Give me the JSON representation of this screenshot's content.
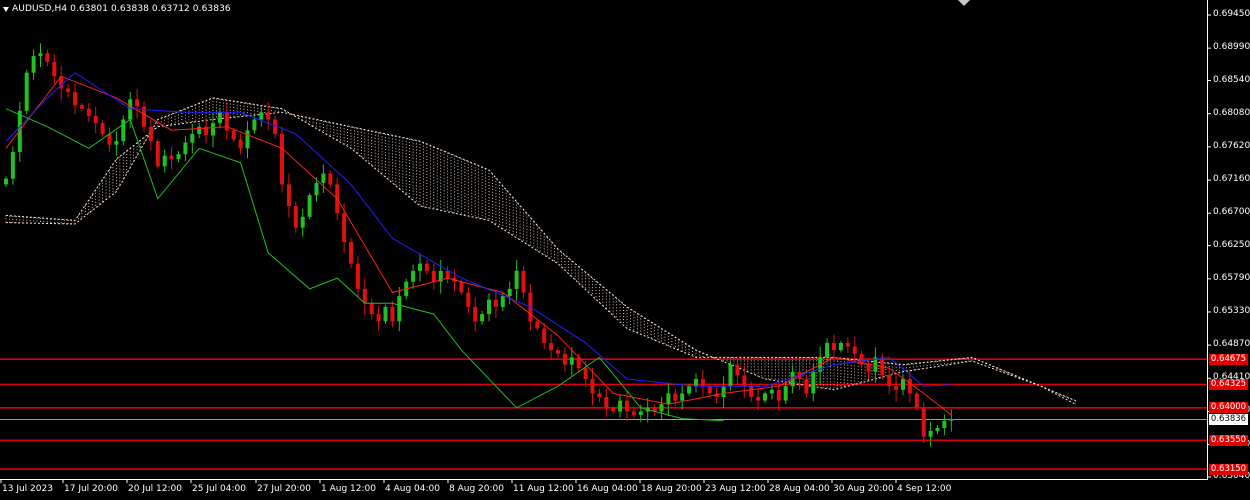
{
  "header": {
    "symbol": "AUDUSD,H4",
    "ohlc": "0.63801 0.63838 0.63712 0.63836"
  },
  "y_axis": {
    "labels": [
      "0.69450",
      "0.68990",
      "0.68540",
      "0.68080",
      "0.67620",
      "0.67160",
      "0.66700",
      "0.66250",
      "0.65790",
      "0.65330",
      "0.64870",
      "0.64410",
      "0.63950",
      "0.63490",
      "0.63040"
    ]
  },
  "x_axis": {
    "labels": [
      "13 Jul 2023",
      "17 Jul 20:00",
      "20 Jul 12:00",
      "25 Jul 04:00",
      "27 Jul 20:00",
      "1 Aug 12:00",
      "4 Aug 04:00",
      "8 Aug 20:00",
      "11 Aug 12:00",
      "16 Aug 04:00",
      "18 Aug 20:00",
      "23 Aug 12:00",
      "28 Aug 04:00",
      "30 Aug 20:00",
      "4 Sep 12:00"
    ]
  },
  "levels": [
    {
      "label": "0.64675",
      "price": 0.64675
    },
    {
      "label": "0.64325",
      "price": 0.64325
    },
    {
      "label": "0.64000",
      "price": 0.64
    },
    {
      "label": "0.63550",
      "price": 0.6355
    },
    {
      "label": "0.63150",
      "price": 0.6315
    }
  ],
  "current_price": {
    "label": "0.63836",
    "price": 0.63836
  },
  "colors": {
    "background": "#000000",
    "bull": "#22c022",
    "bear": "#e01010",
    "level": "#e00000",
    "tenkan": "#ff2020",
    "kijun": "#2020ff",
    "chikou": "#20c020",
    "cloud": "#ffe6d2"
  },
  "chart_data": {
    "type": "candlestick",
    "title": "AUDUSD,H4",
    "ylim": [
      0.6304,
      0.6945
    ],
    "price_path": [
      [
        0,
        0.6718
      ],
      [
        1,
        0.6755
      ],
      [
        2,
        0.6812
      ],
      [
        3,
        0.6865
      ],
      [
        4,
        0.6888
      ],
      [
        5,
        0.6892
      ],
      [
        6,
        0.688
      ],
      [
        7,
        0.686
      ],
      [
        8,
        0.6843
      ],
      [
        9,
        0.6838
      ],
      [
        10,
        0.682
      ],
      [
        11,
        0.6815
      ],
      [
        12,
        0.6805
      ],
      [
        13,
        0.6795
      ],
      [
        14,
        0.678
      ],
      [
        15,
        0.6765
      ],
      [
        16,
        0.677
      ],
      [
        17,
        0.68
      ],
      [
        18,
        0.6828
      ],
      [
        19,
        0.6818
      ],
      [
        20,
        0.679
      ],
      [
        21,
        0.677
      ],
      [
        22,
        0.6735
      ],
      [
        23,
        0.675
      ],
      [
        24,
        0.6745
      ],
      [
        25,
        0.6752
      ],
      [
        26,
        0.6768
      ],
      [
        27,
        0.678
      ],
      [
        28,
        0.679
      ],
      [
        29,
        0.6778
      ],
      [
        30,
        0.6795
      ],
      [
        31,
        0.681
      ],
      [
        32,
        0.6785
      ],
      [
        33,
        0.6772
      ],
      [
        34,
        0.676
      ],
      [
        35,
        0.6785
      ],
      [
        36,
        0.68
      ],
      [
        37,
        0.681
      ],
      [
        38,
        0.68
      ],
      [
        39,
        0.678
      ],
      [
        40,
        0.671
      ],
      [
        41,
        0.668
      ],
      [
        42,
        0.665
      ],
      [
        43,
        0.6665
      ],
      [
        44,
        0.6695
      ],
      [
        45,
        0.6712
      ],
      [
        46,
        0.6725
      ],
      [
        47,
        0.671
      ],
      [
        48,
        0.667
      ],
      [
        49,
        0.663
      ],
      [
        50,
        0.66
      ],
      [
        51,
        0.6565
      ],
      [
        52,
        0.6545
      ],
      [
        53,
        0.653
      ],
      [
        54,
        0.652
      ],
      [
        55,
        0.654
      ],
      [
        56,
        0.652
      ],
      [
        57,
        0.6555
      ],
      [
        58,
        0.6575
      ],
      [
        59,
        0.659
      ],
      [
        60,
        0.66
      ],
      [
        61,
        0.659
      ],
      [
        62,
        0.6575
      ],
      [
        63,
        0.659
      ],
      [
        64,
        0.658
      ],
      [
        65,
        0.6575
      ],
      [
        66,
        0.656
      ],
      [
        67,
        0.654
      ],
      [
        68,
        0.652
      ],
      [
        69,
        0.653
      ],
      [
        70,
        0.655
      ],
      [
        71,
        0.654
      ],
      [
        72,
        0.6555
      ],
      [
        73,
        0.6565
      ],
      [
        74,
        0.659
      ],
      [
        75,
        0.656
      ],
      [
        76,
        0.652
      ],
      [
        77,
        0.651
      ],
      [
        78,
        0.649
      ],
      [
        79,
        0.648
      ],
      [
        80,
        0.6475
      ],
      [
        81,
        0.646
      ],
      [
        82,
        0.647
      ],
      [
        83,
        0.6455
      ],
      [
        84,
        0.644
      ],
      [
        85,
        0.642
      ],
      [
        86,
        0.6415
      ],
      [
        87,
        0.64
      ],
      [
        88,
        0.6395
      ],
      [
        89,
        0.641
      ],
      [
        90,
        0.6395
      ],
      [
        91,
        0.639
      ],
      [
        92,
        0.6395
      ],
      [
        93,
        0.64
      ],
      [
        94,
        0.6395
      ],
      [
        95,
        0.6405
      ],
      [
        96,
        0.642
      ],
      [
        97,
        0.641
      ],
      [
        98,
        0.642
      ],
      [
        99,
        0.643
      ],
      [
        100,
        0.644
      ],
      [
        101,
        0.643
      ],
      [
        102,
        0.642
      ],
      [
        103,
        0.6415
      ],
      [
        104,
        0.643
      ],
      [
        105,
        0.646
      ],
      [
        106,
        0.6445
      ],
      [
        107,
        0.643
      ],
      [
        108,
        0.6415
      ],
      [
        109,
        0.641
      ],
      [
        110,
        0.642
      ],
      [
        111,
        0.6425
      ],
      [
        112,
        0.641
      ],
      [
        113,
        0.643
      ],
      [
        114,
        0.645
      ],
      [
        115,
        0.644
      ],
      [
        116,
        0.642
      ],
      [
        117,
        0.645
      ],
      [
        118,
        0.647
      ],
      [
        119,
        0.649
      ],
      [
        120,
        0.648
      ],
      [
        121,
        0.649
      ],
      [
        122,
        0.6485
      ],
      [
        123,
        0.6475
      ],
      [
        124,
        0.646
      ],
      [
        125,
        0.645
      ],
      [
        126,
        0.647
      ],
      [
        127,
        0.6445
      ],
      [
        128,
        0.643
      ],
      [
        129,
        0.6425
      ],
      [
        130,
        0.644
      ],
      [
        131,
        0.642
      ],
      [
        132,
        0.64
      ],
      [
        133,
        0.636
      ],
      [
        134,
        0.6368
      ],
      [
        135,
        0.6372
      ],
      [
        136,
        0.6382
      ],
      [
        137,
        0.6384
      ]
    ],
    "tenkan": [
      [
        0,
        0.676
      ],
      [
        8,
        0.686
      ],
      [
        16,
        0.683
      ],
      [
        24,
        0.6785
      ],
      [
        32,
        0.679
      ],
      [
        40,
        0.676
      ],
      [
        48,
        0.669
      ],
      [
        56,
        0.656
      ],
      [
        64,
        0.658
      ],
      [
        72,
        0.656
      ],
      [
        80,
        0.65
      ],
      [
        88,
        0.642
      ],
      [
        96,
        0.6405
      ],
      [
        104,
        0.642
      ],
      [
        112,
        0.643
      ],
      [
        120,
        0.647
      ],
      [
        128,
        0.6455
      ],
      [
        133,
        0.642
      ],
      [
        137,
        0.639
      ]
    ],
    "kijun": [
      [
        0,
        0.677
      ],
      [
        6,
        0.683
      ],
      [
        10,
        0.6865
      ],
      [
        18,
        0.6815
      ],
      [
        26,
        0.681
      ],
      [
        34,
        0.681
      ],
      [
        42,
        0.678
      ],
      [
        50,
        0.671
      ],
      [
        56,
        0.6635
      ],
      [
        66,
        0.658
      ],
      [
        76,
        0.654
      ],
      [
        84,
        0.649
      ],
      [
        90,
        0.644
      ],
      [
        100,
        0.643
      ],
      [
        110,
        0.643
      ],
      [
        120,
        0.646
      ],
      [
        128,
        0.647
      ],
      [
        133,
        0.643
      ],
      [
        137,
        0.6432
      ]
    ],
    "chikou": [
      [
        0,
        0.6815
      ],
      [
        6,
        0.679
      ],
      [
        12,
        0.676
      ],
      [
        18,
        0.68
      ],
      [
        22,
        0.669
      ],
      [
        28,
        0.676
      ],
      [
        34,
        0.674
      ],
      [
        38,
        0.6615
      ],
      [
        44,
        0.6565
      ],
      [
        48,
        0.658
      ],
      [
        52,
        0.6545
      ],
      [
        56,
        0.6545
      ],
      [
        62,
        0.653
      ],
      [
        66,
        0.648
      ],
      [
        70,
        0.644
      ],
      [
        74,
        0.64
      ],
      [
        80,
        0.643
      ],
      [
        86,
        0.647
      ],
      [
        92,
        0.64
      ],
      [
        98,
        0.6385
      ],
      [
        104,
        0.6382
      ]
    ],
    "cloud_a": [
      [
        0,
        0.6667
      ],
      [
        10,
        0.666
      ],
      [
        16,
        0.6745
      ],
      [
        22,
        0.679
      ],
      [
        30,
        0.68
      ],
      [
        40,
        0.681
      ],
      [
        50,
        0.679
      ],
      [
        60,
        0.677
      ],
      [
        70,
        0.673
      ],
      [
        80,
        0.662
      ],
      [
        90,
        0.654
      ],
      [
        100,
        0.648
      ],
      [
        110,
        0.644
      ],
      [
        120,
        0.6425
      ],
      [
        130,
        0.645
      ],
      [
        140,
        0.6465
      ],
      [
        150,
        0.643
      ],
      [
        155,
        0.6405
      ]
    ],
    "cloud_b": [
      [
        0,
        0.6657
      ],
      [
        10,
        0.6655
      ],
      [
        16,
        0.67
      ],
      [
        22,
        0.68
      ],
      [
        30,
        0.683
      ],
      [
        40,
        0.6815
      ],
      [
        50,
        0.676
      ],
      [
        60,
        0.668
      ],
      [
        70,
        0.666
      ],
      [
        80,
        0.66
      ],
      [
        90,
        0.651
      ],
      [
        100,
        0.647
      ],
      [
        110,
        0.647
      ],
      [
        120,
        0.647
      ],
      [
        130,
        0.646
      ],
      [
        140,
        0.647
      ],
      [
        150,
        0.643
      ],
      [
        155,
        0.641
      ]
    ]
  }
}
